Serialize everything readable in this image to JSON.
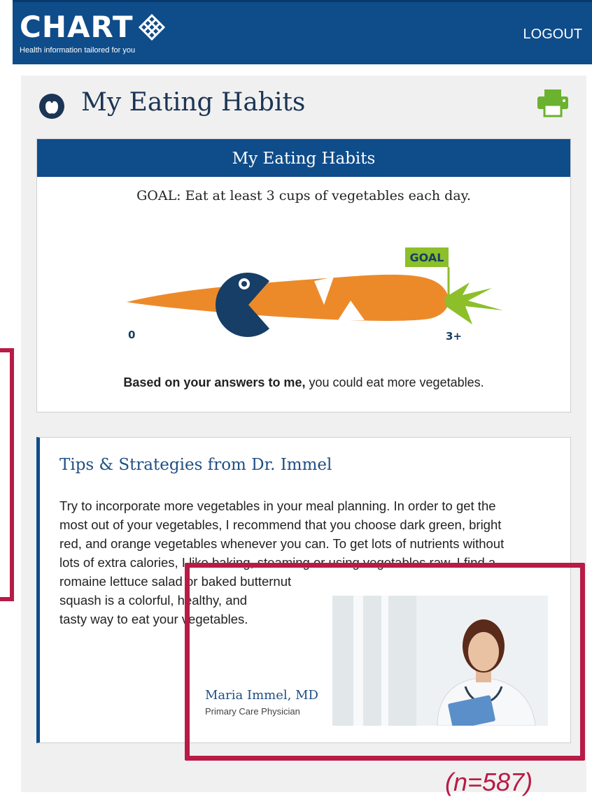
{
  "header": {
    "logo_text": "CHART",
    "tagline": "Health information tailored for you",
    "logout_label": "LOGOUT"
  },
  "page": {
    "title": "My Eating Habits",
    "icon": "apple-icon",
    "print_icon": "printer-icon"
  },
  "habits_card": {
    "heading": "My Eating Habits",
    "goal": "GOAL: Eat at least 3 cups of vegetables each day.",
    "scale_min_label": "0",
    "scale_max_label": "3+",
    "goal_flag": "GOAL",
    "feedback_bold": "Based on your answers to me,",
    "feedback_rest": " you could eat more vegetables.",
    "consumed_fraction": 0.25
  },
  "tips": {
    "title": "Tips & Strategies from Dr. Immel",
    "line1": "Try to incorporate more vegetables in your meal planning. In order to get the",
    "line2": "most out of your vegetables, I recommend that you choose dark green, bright",
    "line3": "red, and orange vegetables whenever you can. To get lots of nutrients without",
    "line4": "lots of extra calories, I like baking, steaming or using vegetables raw. I find a",
    "line5": "romaine lettuce salad or baked butternut",
    "line6": "squash is a colorful, healthy, and",
    "line7": "tasty way to eat your vegetables.",
    "doctor_name": "Maria Immel, MD",
    "doctor_role": "Primary Care Physician"
  },
  "annotation": {
    "n_label": "(n=587)"
  },
  "colors": {
    "header_blue": "#0f4c8a",
    "carrot_orange": "#ec8a2a",
    "leaf_green": "#8cbf2a",
    "pacman_navy": "#163e66",
    "highlight_red": "#b81b46"
  }
}
